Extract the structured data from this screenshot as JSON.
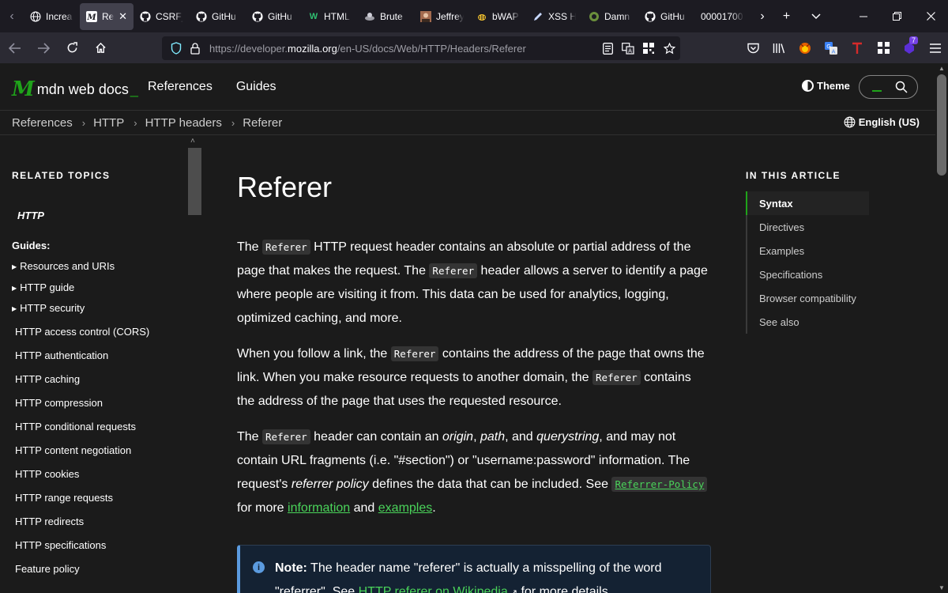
{
  "browser": {
    "tabs": [
      {
        "title": "Increa",
        "icon": "globe-icon"
      },
      {
        "title": "Refe",
        "icon": "mdn-icon",
        "active": true
      },
      {
        "title": "CSRF_",
        "icon": "github-icon"
      },
      {
        "title": "GitHu",
        "icon": "github-icon"
      },
      {
        "title": "GitHu",
        "icon": "github-icon"
      },
      {
        "title": "HTML",
        "icon": "w-icon"
      },
      {
        "title": "Brute",
        "icon": "brute-icon"
      },
      {
        "title": "Jeffrey",
        "icon": "avatar-icon"
      },
      {
        "title": "bWAP",
        "icon": "bee-icon"
      },
      {
        "title": "XSS H",
        "icon": "pen-icon"
      },
      {
        "title": "Damn",
        "icon": "dvwa-icon"
      },
      {
        "title": "GitHu",
        "icon": "github-icon"
      },
      {
        "title": "00001700",
        "icon": ""
      }
    ],
    "url_prefix": "https://developer.",
    "url_domain": "mozilla.org",
    "url_suffix": "/en-US/docs/Web/HTTP/Headers/Referer",
    "extension_badge": "7"
  },
  "mdn": {
    "logo_mark": "M",
    "logo_text": "mdn web docs",
    "logo_cursor": "_",
    "nav": [
      "References",
      "Guides"
    ],
    "theme_label": "Theme",
    "language": "English (US)"
  },
  "breadcrumbs": [
    "References",
    "HTTP",
    "HTTP headers",
    "Referer"
  ],
  "sidebar": {
    "heading": "RELATED TOPICS",
    "section": "HTTP",
    "guides_label": "Guides:",
    "expandable": [
      "Resources and URIs",
      "HTTP guide",
      "HTTP security"
    ],
    "items": [
      "HTTP access control (CORS)",
      "HTTP authentication",
      "HTTP caching",
      "HTTP compression",
      "HTTP conditional requests",
      "HTTP content negotiation",
      "HTTP cookies",
      "HTTP range requests",
      "HTTP redirects",
      "HTTP specifications",
      "Feature policy"
    ]
  },
  "article": {
    "title": "Referer",
    "p1": {
      "a": "The ",
      "code1": "Referer",
      "b": " HTTP request header contains an absolute or partial address of the page that makes the request. The ",
      "code2": "Referer",
      "c": " header allows a server to identify a page where people are visiting it from. This data can be used for analytics, logging, optimized caching, and more."
    },
    "p2": {
      "a": "When you follow a link, the ",
      "code1": "Referer",
      "b": " contains the address of the page that owns the link. When you make resource requests to another domain, the ",
      "code2": "Referer",
      "c": " contains the address of the page that uses the requested resource."
    },
    "p3": {
      "a": "The ",
      "code1": "Referer",
      "b": " header can contain an ",
      "em1": "origin",
      "c": ", ",
      "em2": "path",
      "d": ", and ",
      "em3": "querystring",
      "e": ", and may not contain URL fragments (i.e. \"#section\") or \"username:password\" information. The request's ",
      "em4": "referrer policy",
      "f": " defines the data that can be included. See ",
      "code2": "Referrer-Policy",
      "g": " for more ",
      "link1": "information",
      "h": " and ",
      "link2": "examples",
      "i": "."
    },
    "note": {
      "label": "Note:",
      "text": " The header name \"referer\" is actually a misspelling of the word \"referrer\". See ",
      "link": "HTTP referer on Wikipedia",
      "after": " for more details."
    }
  },
  "toc": {
    "heading": "IN THIS ARTICLE",
    "items": [
      "Syntax",
      "Directives",
      "Examples",
      "Specifications",
      "Browser compatibility",
      "See also"
    ]
  }
}
